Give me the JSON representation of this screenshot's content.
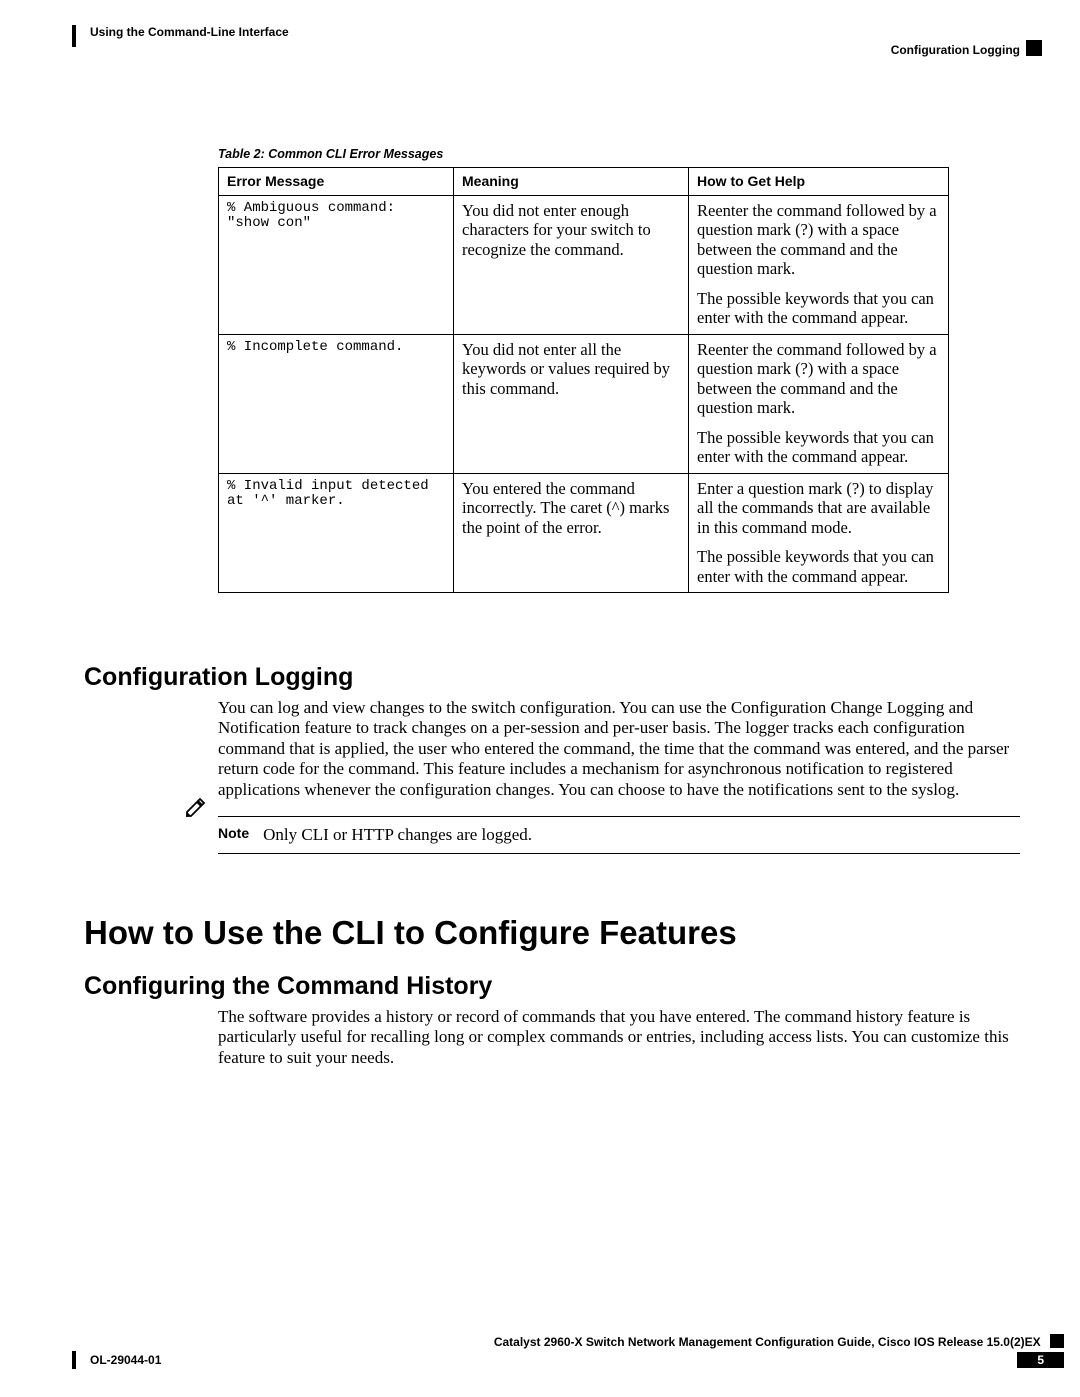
{
  "header": {
    "left": "Using the Command-Line Interface",
    "right": "Configuration Logging"
  },
  "table": {
    "caption": "Table 2: Common CLI Error Messages",
    "headers": [
      "Error Message",
      "Meaning",
      "How to Get Help"
    ],
    "rows": [
      {
        "err": "% Ambiguous command: \"show con\"",
        "meaning": "You did not enter enough characters for your switch to recognize the command.",
        "help1": "Reenter the command followed by a question mark (?) with a space between the command and the question mark.",
        "help2": "The possible keywords that you can enter with the command appear."
      },
      {
        "err": "% Incomplete command.",
        "meaning": "You did not enter all the keywords or values required by this command.",
        "help1": "Reenter the command followed by a question mark (?) with a space between the command and the question mark.",
        "help2": "The possible keywords that you can enter with the command appear."
      },
      {
        "err": "% Invalid input detected at '^' marker.",
        "meaning": "You entered the command incorrectly. The caret (^) marks the point of the error.",
        "help1": "Enter a question mark (?) to display all the commands that are available in this command mode.",
        "help2": "The possible keywords that you can enter with the command appear."
      }
    ]
  },
  "section1": {
    "title": "Configuration Logging",
    "body": "You can log and view changes to the switch configuration. You can use the Configuration Change Logging and Notification feature to track changes on a per-session and per-user basis. The logger tracks each configuration command that is applied, the user who entered the command, the time that the command was entered, and the parser return code for the command. This feature includes a mechanism for asynchronous notification to registered applications whenever the configuration changes. You can choose to have the notifications sent to the syslog.",
    "note_label": "Note",
    "note_text": "Only CLI or HTTP changes are logged."
  },
  "chapter": {
    "title": "How to Use the CLI to Configure Features"
  },
  "section2": {
    "title": "Configuring the Command History",
    "body": "The software provides a history or record of commands that you have entered. The command history feature is particularly useful for recalling long or complex commands or entries, including access lists. You can customize this feature to suit your needs."
  },
  "footer": {
    "guide": "Catalyst 2960-X Switch Network Management Configuration Guide, Cisco IOS Release 15.0(2)EX",
    "docnum": "OL-29044-01",
    "page": "5"
  }
}
